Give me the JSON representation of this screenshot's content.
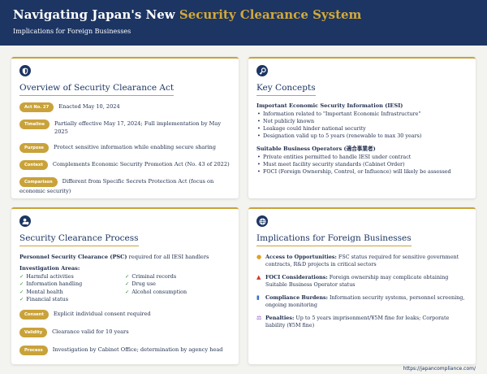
{
  "header": {
    "title_main": "Navigating Japan's New ",
    "title_highlight": "Security Clearance System",
    "subtitle": "Implications for Foreign Businesses"
  },
  "overview": {
    "icon": "shield-icon",
    "title": "Overview of Security Clearance Act",
    "rows": [
      {
        "badge": "Act No. 27",
        "text": "Enacted May 10, 2024"
      },
      {
        "badge": "Timeline",
        "text": "Partially effective May 17, 2024; Full implementation by May 2025"
      },
      {
        "badge": "Purpose",
        "text": "Protect sensitive information while enabling secure sharing"
      },
      {
        "badge": "Context",
        "text": "Complements Economic Security Promotion Act (No. 43 of 2022)"
      },
      {
        "badge": "Comparison",
        "text": "Different from Specific Secrets Protection Act (focus on economic security)"
      }
    ]
  },
  "concepts": {
    "icon": "key-icon",
    "title": "Key Concepts",
    "sections": [
      {
        "heading": "Important Economic Security Information (IESI)",
        "items": [
          "Information related to \"Important Economic Infrastructure\"",
          "Not publicly known",
          "Leakage could hinder national security",
          "Designation valid up to 5 years (renewable to max 30 years)"
        ]
      },
      {
        "heading": "Suitable Business Operators (適合事業者)",
        "items": [
          "Private entities permitted to handle IESI under contract",
          "Must meet facility security standards (Cabinet Order)",
          "FOCI (Foreign Ownership, Control, or Influence) will likely be assessed"
        ]
      }
    ]
  },
  "process": {
    "icon": "user-shield-icon",
    "title": "Security Clearance Process",
    "psc_bold": "Personnel Security Clearance (PSC)",
    "psc_rest": " required for all IESI handlers",
    "areas_heading": "Investigation Areas:",
    "areas_left": [
      "Harmful activities",
      "Information handling",
      "Mental health",
      "Financial status"
    ],
    "areas_right": [
      "Criminal records",
      "Drug use",
      "Alcohol consumption"
    ],
    "rows": [
      {
        "badge": "Consent",
        "text": "Explicit individual consent required"
      },
      {
        "badge": "Validity",
        "text": "Clearance valid for 10 years"
      },
      {
        "badge": "Process",
        "text": "Investigation by Cabinet Office; determination by agency head"
      }
    ]
  },
  "implications": {
    "icon": "globe-icon",
    "title": "Implications for Foreign Businesses",
    "items": [
      {
        "icon": "lightbulb-icon",
        "glyph": "💡",
        "color": "#e0a020",
        "label": "Access to Opportunities:",
        "text": " FSC status required for sensitive government contracts, R&D projects in critical sectors"
      },
      {
        "icon": "warning-icon",
        "glyph": "▲",
        "color": "#d03a2a",
        "label": "FOCI Considerations:",
        "text": " Foreign ownership may complicate obtaining Suitable Business Operator status"
      },
      {
        "icon": "clipboard-icon",
        "glyph": "▮",
        "color": "#3b6fc4",
        "label": "Compliance Burdens:",
        "text": " Information security systems, personnel screening, ongoing monitoring"
      },
      {
        "icon": "scales-icon",
        "glyph": "⚖",
        "color": "#8a4fc0",
        "label": "Penalties:",
        "text": " Up to 5 years imprisonment/¥5M fine for leaks; Corporate liability (¥5M fine)"
      }
    ]
  },
  "footer": {
    "url": "https://japancompliance.com/"
  },
  "colors": {
    "navy": "#1c3563",
    "gold": "#c9a23a"
  }
}
